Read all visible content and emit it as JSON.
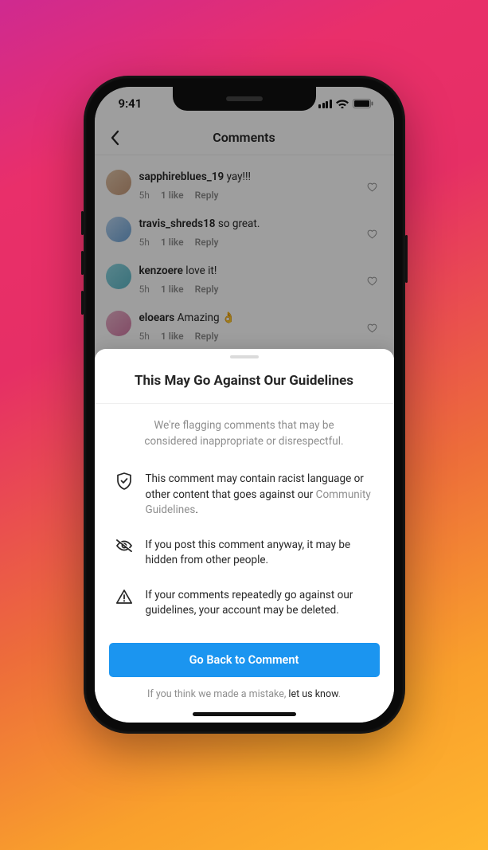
{
  "status_bar": {
    "time": "9:41"
  },
  "header": {
    "title": "Comments"
  },
  "meta_labels": {
    "likes_singular": "1 like",
    "reply": "Reply"
  },
  "comments": [
    {
      "username": "sapphireblues_19",
      "text": "yay!!!",
      "age": "5h",
      "avatar_bg": "linear-gradient(135deg,#e0c4a8,#c69a7a)"
    },
    {
      "username": "travis_shreds18",
      "text": "so great.",
      "age": "5h",
      "avatar_bg": "linear-gradient(135deg,#b9d4ef,#6ea3d6)"
    },
    {
      "username": "kenzoere",
      "text": "love it!",
      "age": "5h",
      "avatar_bg": "linear-gradient(135deg,#8fd6e1,#5db7c6)"
    },
    {
      "username": "eloears",
      "text": "Amazing 👌",
      "age": "5h",
      "avatar_bg": "linear-gradient(135deg,#e8b1c8,#d37ba6)"
    }
  ],
  "sheet": {
    "title": "This May Go Against Our Guidelines",
    "intro": "We're flagging comments that may be considered inappropriate or disrespectful.",
    "items": [
      {
        "text_pre": "This comment may contain racist language or other content that goes against our ",
        "link": "Community Guidelines",
        "text_post": "."
      },
      {
        "text_pre": "If you post this comment anyway, it may be hidden from other people.",
        "link": "",
        "text_post": ""
      },
      {
        "text_pre": "If your comments repeatedly go against our guidelines, your account may be deleted.",
        "link": "",
        "text_post": ""
      }
    ],
    "button": "Go Back to Comment",
    "mistake_pre": "If you think we made a mistake, ",
    "mistake_link": "let us know",
    "mistake_post": "."
  }
}
